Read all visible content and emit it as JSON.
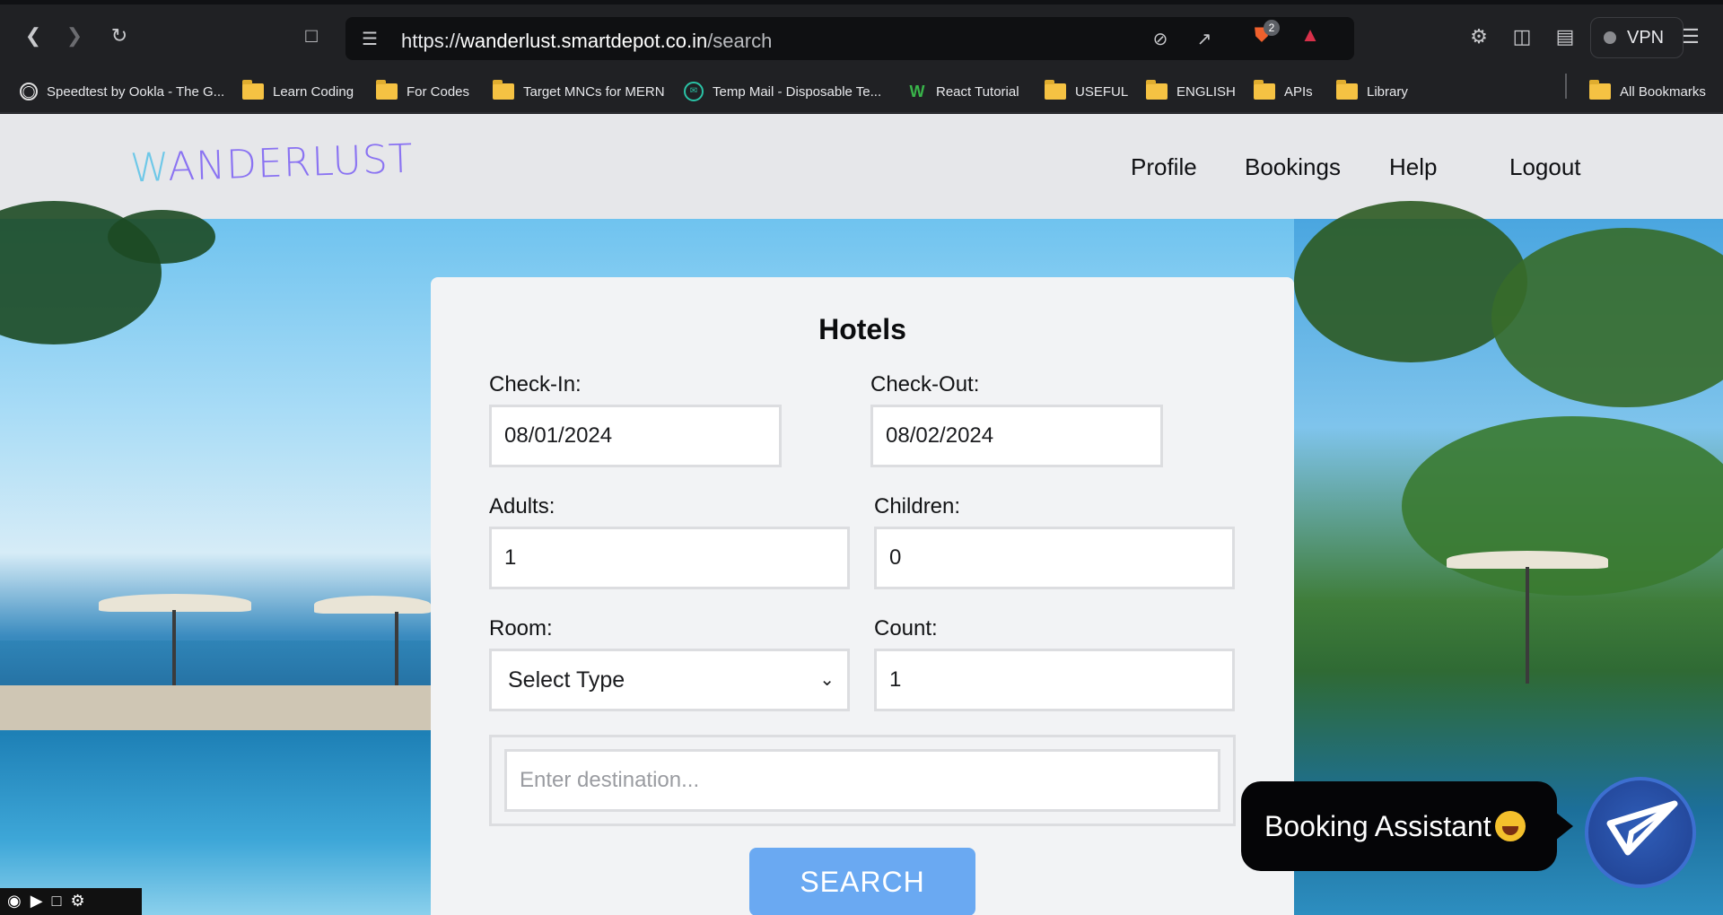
{
  "browser": {
    "url_scheme": "https://",
    "url_host": "wanderlust.smartdepot.co.in",
    "url_path": "/search",
    "shield_badge_count": "2",
    "vpn_label": "VPN",
    "bookmarks": [
      {
        "label": "Speedtest by Ookla - The G...",
        "icon": "speedtest-icon"
      },
      {
        "label": "Learn Coding",
        "icon": "folder-icon"
      },
      {
        "label": "For Codes",
        "icon": "folder-icon"
      },
      {
        "label": "Target MNCs for MERN",
        "icon": "folder-icon"
      },
      {
        "label": "Temp Mail - Disposable Te...",
        "icon": "tempmail-icon"
      },
      {
        "label": "React Tutorial",
        "icon": "w3schools-icon"
      },
      {
        "label": "USEFUL",
        "icon": "folder-icon"
      },
      {
        "label": "ENGLISH",
        "icon": "folder-icon"
      },
      {
        "label": "APIs",
        "icon": "folder-icon"
      },
      {
        "label": "Library",
        "icon": "folder-icon"
      }
    ],
    "all_bookmarks_label": "All Bookmarks"
  },
  "site": {
    "logo_first": "W",
    "logo_rest": "ANDERLUST",
    "nav": {
      "profile": "Profile",
      "bookings": "Bookings",
      "help": "Help",
      "logout": "Logout"
    }
  },
  "form": {
    "title": "Hotels",
    "checkin_label": "Check-In:",
    "checkin_value": "08/01/2024",
    "checkout_label": "Check-Out:",
    "checkout_value": "08/02/2024",
    "adults_label": "Adults:",
    "adults_value": "1",
    "children_label": "Children:",
    "children_value": "0",
    "room_label": "Room:",
    "room_value": "Select Type",
    "count_label": "Count:",
    "count_value": "1",
    "destination_placeholder": "Enter destination...",
    "search_label": "SEARCH"
  },
  "assistant": {
    "label": "Booking Assistant"
  }
}
